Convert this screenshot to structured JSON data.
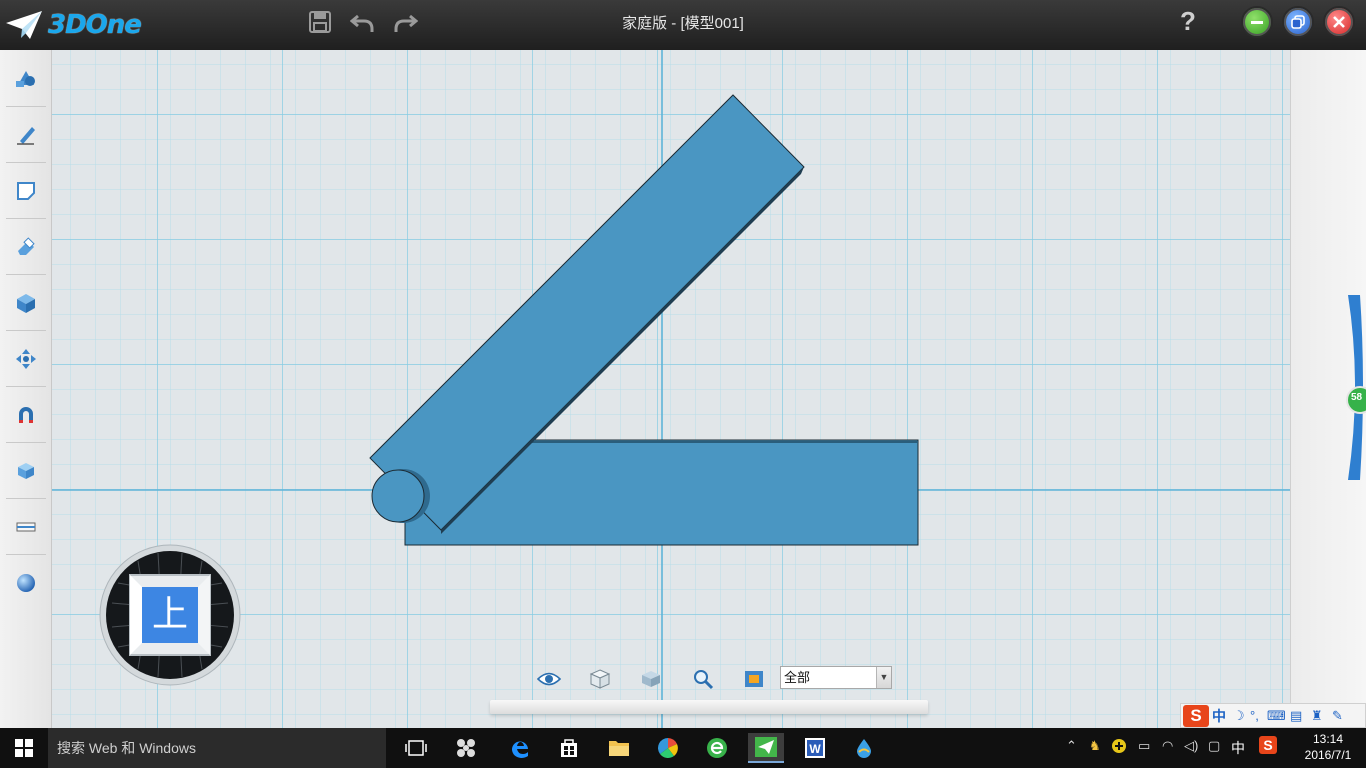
{
  "app": {
    "logo_text": "3DOne"
  },
  "titlebar": {
    "document_title": "家庭版 - [模型001]",
    "help_label": "?"
  },
  "viewport": {
    "model_color": "#4a96c2",
    "grid_minor_color": "#aed9e8",
    "grid_major_color": "#7fc7e0"
  },
  "viewcube": {
    "face_label": "上"
  },
  "filter": {
    "selected_option": "全部"
  },
  "right_slider": {
    "value_label": "58"
  },
  "taskbar": {
    "search_placeholder": "搜索 Web 和 Windows",
    "ime_label": "中",
    "time": "13:14",
    "date": "2016/7/1"
  },
  "ime_toolbar": {
    "mode_label": "中"
  }
}
